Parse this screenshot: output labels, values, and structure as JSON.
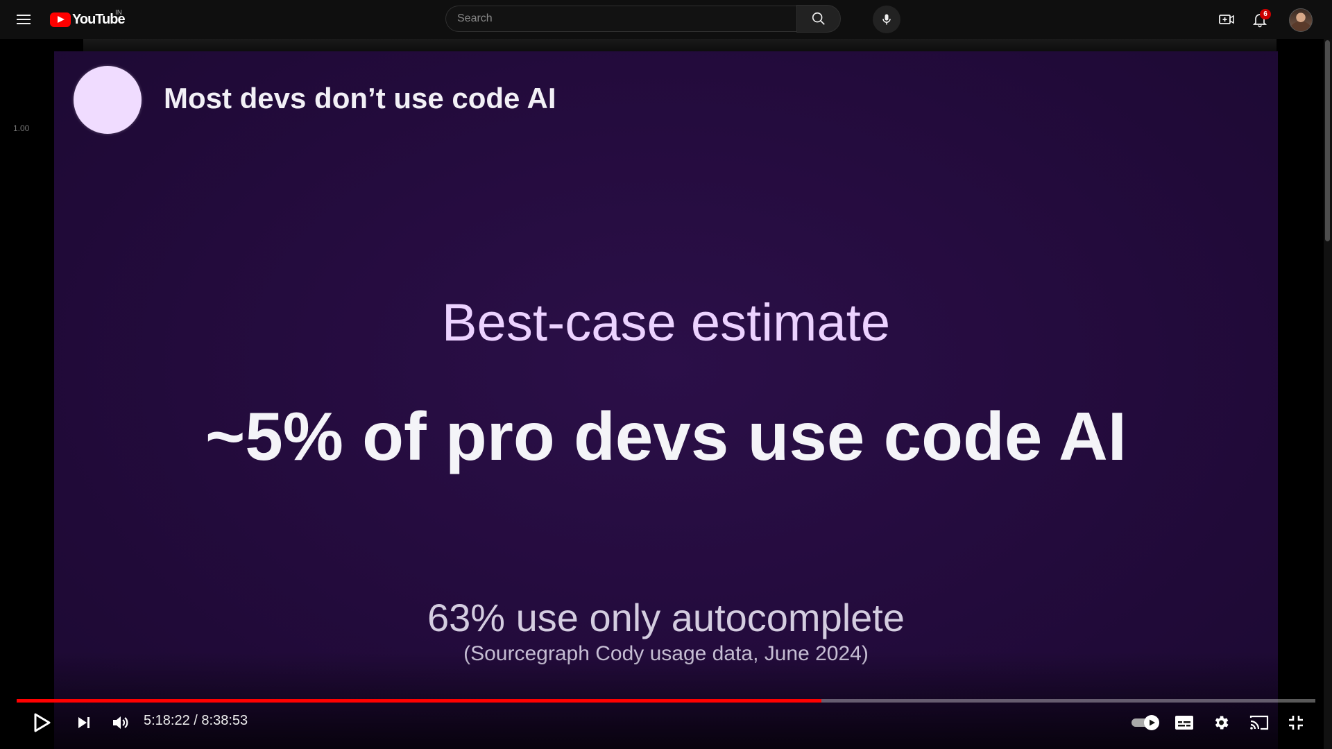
{
  "masthead": {
    "menu_icon": "hamburger-menu-icon",
    "logo_text": "YouTube",
    "region": "IN",
    "search_placeholder": "Search",
    "notification_count": "6"
  },
  "player": {
    "side_label": "1.00",
    "slide": {
      "title": "Most devs don’t use code AI",
      "subtitle": "Best-case estimate",
      "headline": "~5% of pro devs use code AI",
      "stat": "63% use only autocomplete",
      "source": "(Sourcegraph Cody usage data, June 2024)"
    },
    "current_time": "5:18:22",
    "time_separator": " / ",
    "duration": "8:38:53",
    "progress_fraction": 0.6195,
    "autoplay_on": true
  },
  "colors": {
    "accent": "#ff0000",
    "slide_bg": "#230b3c",
    "badge": "#cc0000"
  }
}
